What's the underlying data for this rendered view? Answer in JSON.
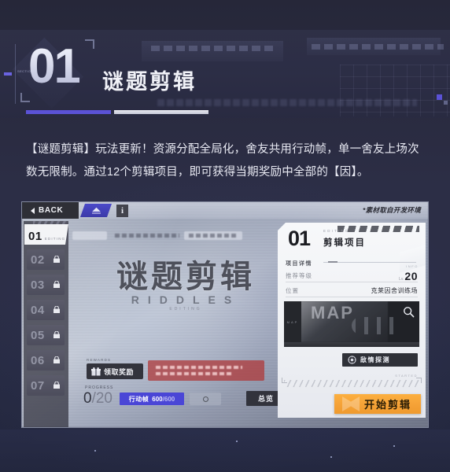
{
  "page": {
    "background_color": "#262a42",
    "accent_purple": "#5b52d6",
    "accent_orange": "#f6a338"
  },
  "header": {
    "number": "01",
    "title": "谜题剪辑",
    "tick_label": "SECTION"
  },
  "description": "【谜题剪辑】玩法更新！资源分配全局化，舍友共用行动帧，单一舍友上场次数无限制。通过12个剪辑项目，即可获得当期奖励中全部的【因】。",
  "screenshot": {
    "topbar": {
      "back_label": "BACK",
      "info_label": "i",
      "dev_note": "*素材取自开发环境"
    },
    "rail": {
      "items": [
        {
          "label": "01",
          "sub": "EDITING",
          "locked": false,
          "active": true
        },
        {
          "label": "02",
          "locked": true,
          "active": false
        },
        {
          "label": "03",
          "locked": true,
          "active": false
        },
        {
          "label": "04",
          "locked": true,
          "active": false
        },
        {
          "label": "05",
          "locked": true,
          "active": false
        },
        {
          "label": "06",
          "locked": true,
          "active": false
        },
        {
          "label": "07",
          "locked": true,
          "active": false
        }
      ]
    },
    "center": {
      "title_cn": "谜题剪辑",
      "title_en": "RIDDLES",
      "title_en_sub": "EDITING"
    },
    "hud": {
      "reward_small_label": "REWARDS",
      "reward_button": "领取奖励",
      "progress_small_label": "PROGRESS",
      "progress_current": "0",
      "progress_sep": "/",
      "progress_total": "20",
      "frame_key": "行动帧",
      "frame_value": "600",
      "frame_max": "/600",
      "total_button": "总览"
    },
    "card": {
      "number": "01",
      "sub_en": "EDITING",
      "title": "剪辑项目",
      "section_label": "项目详情",
      "section_info": "INFO",
      "rows": [
        {
          "key": "推荐等级",
          "lv_prefix": "Lv.",
          "value": "20"
        },
        {
          "key": "位置",
          "value": "克莱因舍训练场"
        }
      ],
      "map": {
        "text": "MAP",
        "side_text": "MAP",
        "search_icon": "magnifier-icon"
      },
      "detect_button": "敌情探测",
      "start_small_label": "STARTED",
      "start_button": "开始剪辑"
    }
  }
}
